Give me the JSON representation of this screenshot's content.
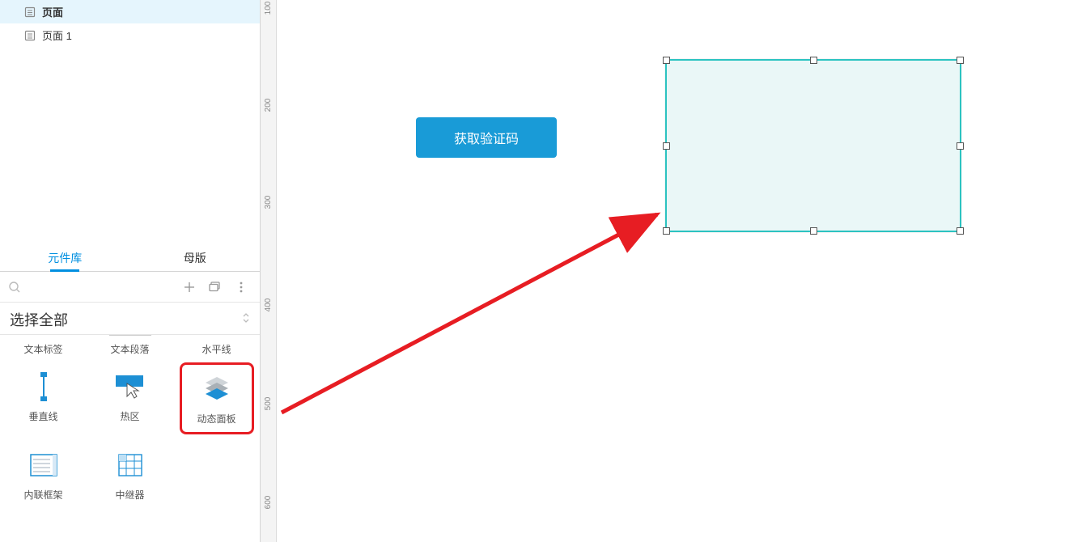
{
  "pages": {
    "items": [
      {
        "label": "页面",
        "selected": true
      },
      {
        "label": "页面 1",
        "selected": false
      }
    ]
  },
  "library": {
    "tabs": {
      "widgets": "元件库",
      "masters": "母版"
    },
    "select_all": "选择全部",
    "row1": [
      "文本标签",
      "文本段落",
      "水平线"
    ],
    "row2": [
      "垂直线",
      "热区",
      "动态面板"
    ],
    "row3": [
      "内联框架",
      "中继器"
    ]
  },
  "canvas": {
    "button_label": "获取验证码",
    "vruler_ticks": [
      "100",
      "200",
      "300",
      "400",
      "500",
      "600"
    ]
  }
}
